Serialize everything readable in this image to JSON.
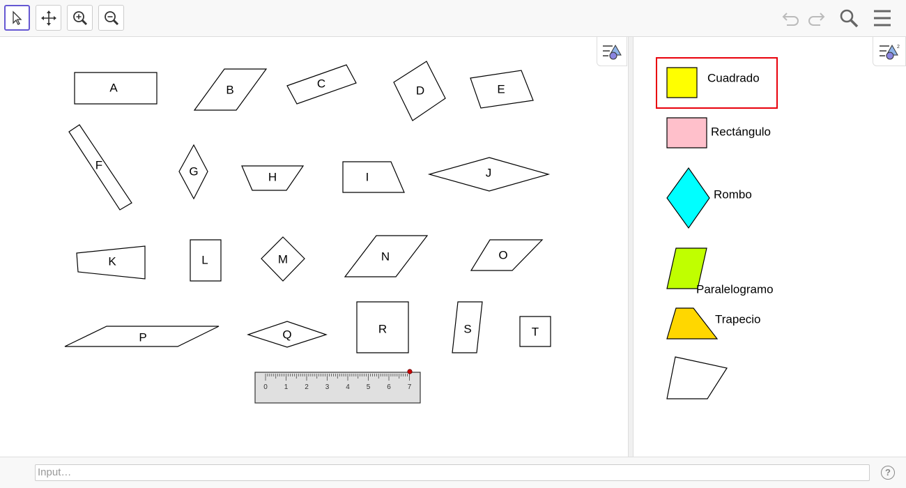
{
  "toolbar": {
    "tools": [
      {
        "icon": "move-arrow-icon",
        "active": true
      },
      {
        "icon": "move-graphics-view-icon",
        "active": false
      },
      {
        "icon": "zoom-in-icon",
        "active": false
      },
      {
        "icon": "zoom-out-icon",
        "active": false
      }
    ],
    "right_icons": [
      "undo-icon",
      "redo-icon",
      "search-icon",
      "menu-icon"
    ]
  },
  "graphics_view": {
    "shapes": [
      "A",
      "B",
      "C",
      "D",
      "E",
      "F",
      "G",
      "H",
      "I",
      "J",
      "K",
      "L",
      "M",
      "N",
      "O",
      "P",
      "Q",
      "R",
      "S",
      "T"
    ],
    "ruler": {
      "ticks": [
        "0",
        "1",
        "2",
        "3",
        "4",
        "5",
        "6",
        "7"
      ],
      "marker_color": "#cc0000"
    }
  },
  "classification_panel": {
    "categories": [
      {
        "label": "Cuadrado",
        "color": "#ffff00",
        "selected": true
      },
      {
        "label": "Rectángulo",
        "color": "#ffc0cb",
        "selected": false
      },
      {
        "label": "Rombo",
        "color": "#00ffff",
        "selected": false
      },
      {
        "label": "Paralelogramo",
        "color": "#c0ff00",
        "selected": false
      },
      {
        "label": "Trapecio",
        "color": "#ffd700",
        "selected": false
      },
      {
        "label": "",
        "color": "#ffffff",
        "selected": false
      }
    ],
    "selection_color": "#e8000b"
  },
  "input_bar": {
    "placeholder": "Input…",
    "help_label": "?"
  },
  "colors": {
    "accent": "#6557d2",
    "toolbar_bg": "#f8f8f8"
  }
}
